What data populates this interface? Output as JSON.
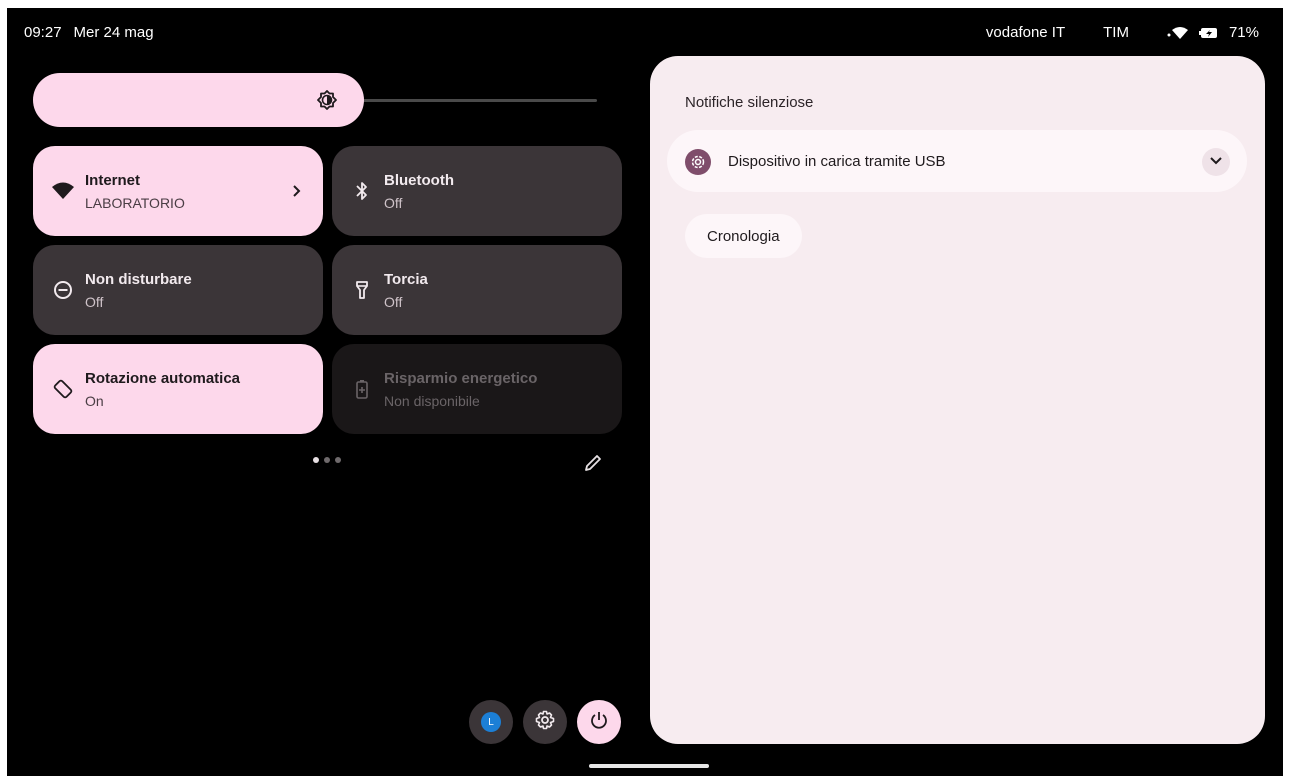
{
  "status_bar": {
    "time": "09:27",
    "date": "Mer 24 mag",
    "carrier_1": "vodafone IT",
    "carrier_2": "TIM",
    "battery": "71%"
  },
  "brightness": {
    "level": 0.56,
    "icon": "brightness-icon"
  },
  "tiles": [
    {
      "label": "Internet",
      "sub": "LABORATORIO",
      "state": "on",
      "icon": "wifi-icon"
    },
    {
      "label": "Bluetooth",
      "sub": "Off",
      "state": "off",
      "icon": "bluetooth-icon"
    },
    {
      "label": "Non disturbare",
      "sub": "Off",
      "state": "off",
      "icon": "do-not-disturb-icon"
    },
    {
      "label": "Torcia",
      "sub": "Off",
      "state": "off",
      "icon": "flashlight-icon"
    },
    {
      "label": "Rotazione automatica",
      "sub": "On",
      "state": "on",
      "icon": "auto-rotate-icon"
    },
    {
      "label": "Risparmio energetico",
      "sub": "Non disponibile",
      "state": "disabled",
      "icon": "battery-saver-icon"
    }
  ],
  "pager": {
    "pages": 3,
    "current": 1
  },
  "bottom_actions": {
    "user_initial": "L"
  },
  "notifications": {
    "section_title": "Notifiche silenziose",
    "items": [
      {
        "text": "Dispositivo in carica tramite USB",
        "icon": "usb-settings-icon"
      }
    ],
    "history_label": "Cronologia"
  },
  "colors": {
    "tile_on": "#fdd8eb",
    "tile_off": "#3b3538",
    "panel_bg": "#f7ecf0",
    "accent": "#7f4d6b"
  }
}
